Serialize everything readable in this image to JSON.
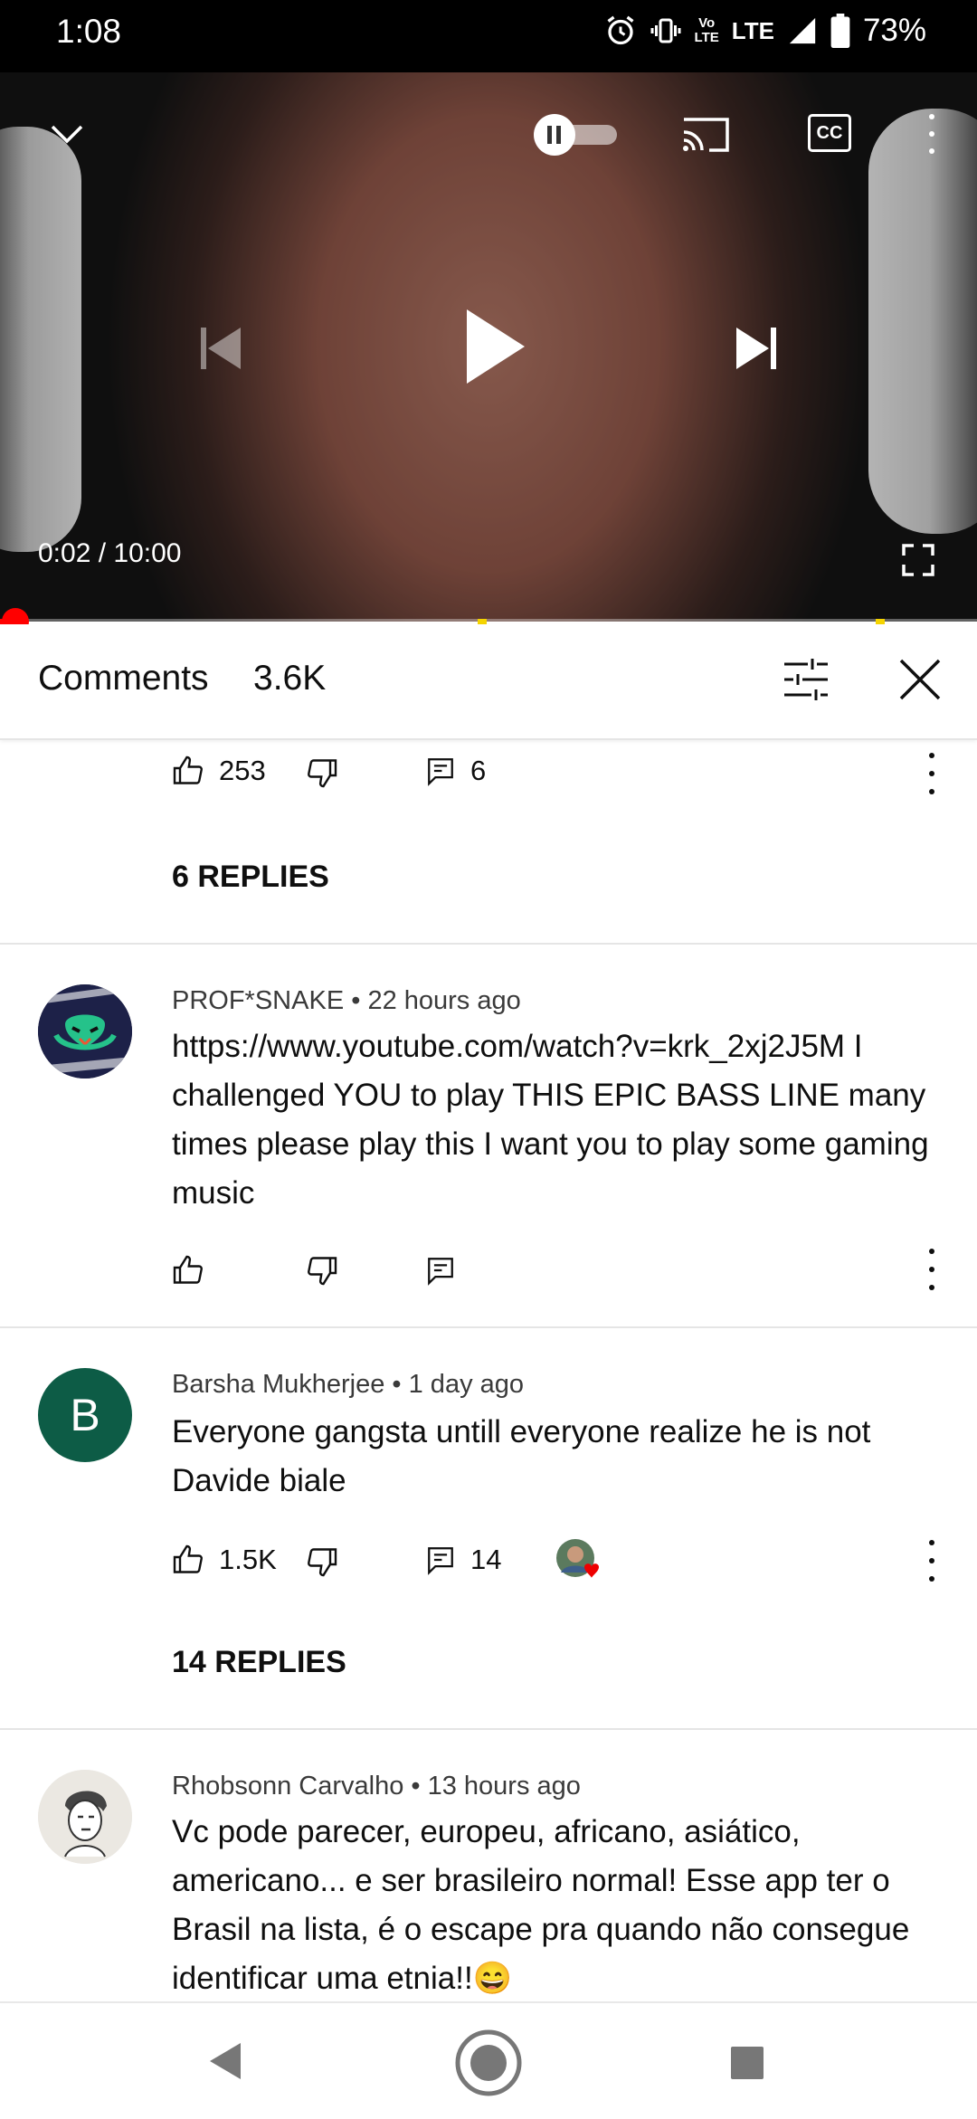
{
  "status_bar": {
    "time": "1:08",
    "lte_small_1": "Vo",
    "lte_small_2": "LTE",
    "lte": "LTE",
    "battery": "73%"
  },
  "player": {
    "time_display": "0:02 / 10:00",
    "progress_fraction": 0.0033,
    "icons": [
      "collapse-chevron-icon",
      "autoplay-toggle",
      "cast-icon",
      "captions-icon",
      "more-vert-icon",
      "previous-icon",
      "play-icon",
      "next-icon",
      "fullscreen-icon"
    ],
    "captions_label": "CC"
  },
  "comments_panel": {
    "title": "Comments",
    "count": "3.6K"
  },
  "comments": [
    {
      "likes": "253",
      "replies_count": "6",
      "replies_label": "6 REPLIES"
    },
    {
      "author": "PROF*SNAKE",
      "time": "22 hours ago",
      "text": "https://www.youtube.com/watch?v=krk_2xj2J5M I challenged YOU to play THIS EPIC BASS LINE many times please play this I want you to play some gaming music",
      "likes": "",
      "replies_count": ""
    },
    {
      "author": "Barsha Mukherjee",
      "time": "1 day ago",
      "avatar_letter": "B",
      "avatar_color": "#0d5c46",
      "text": "Everyone gangsta untill everyone realize he is not Davide biale",
      "likes": "1.5K",
      "replies_count": "14",
      "replies_label": "14 REPLIES"
    },
    {
      "author": "Rhobsonn Carvalho",
      "time": "13 hours ago",
      "text": "Vc pode parecer, europeu, africano, asiático, americano... e ser brasileiro normal! Esse app ter o Brasil na lista, é o escape pra quando não consegue identificar uma etnia!!😄"
    }
  ],
  "colors": {
    "accent_red": "#ff0000",
    "chapter_marker": "#f5d400"
  }
}
